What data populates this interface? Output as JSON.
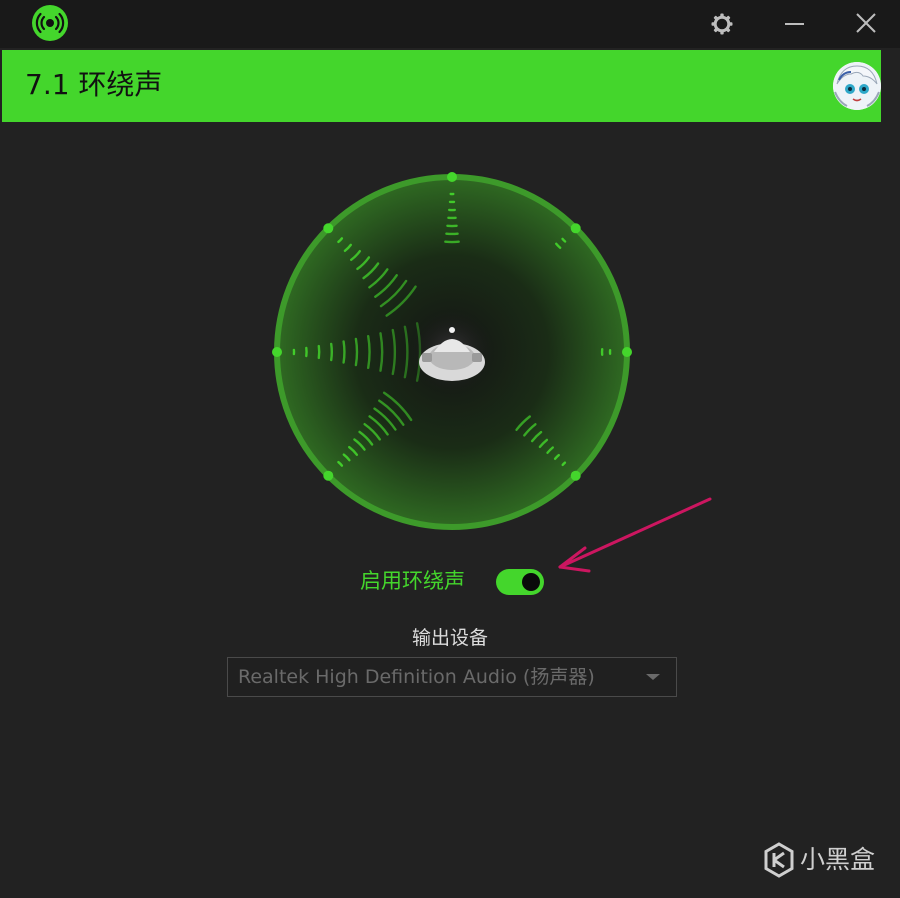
{
  "titlebar": {
    "app_icon": "surround-sound-icon",
    "settings_icon": "gear-icon",
    "minimize_icon": "minimize-icon",
    "close_icon": "close-icon"
  },
  "header": {
    "title": "7.1 环绕声",
    "avatar_icon": "user-avatar"
  },
  "surround": {
    "center_icon": "head-listener-icon",
    "speaker_icons": [
      "front-center",
      "front-right",
      "right",
      "rear-right",
      "rear-left",
      "left",
      "front-left"
    ],
    "accent_color": "#44d62c"
  },
  "toggle": {
    "label": "启用环绕声",
    "enabled": true
  },
  "output": {
    "label": "输出设备",
    "device": "Realtek High Definition Audio (扬声器)"
  },
  "annotation": {
    "arrow_color": "#cc1660"
  },
  "watermark": {
    "text": "小黑盒"
  },
  "colors": {
    "accent": "#44d62c",
    "background": "#222222",
    "titlebar": "#191919"
  }
}
